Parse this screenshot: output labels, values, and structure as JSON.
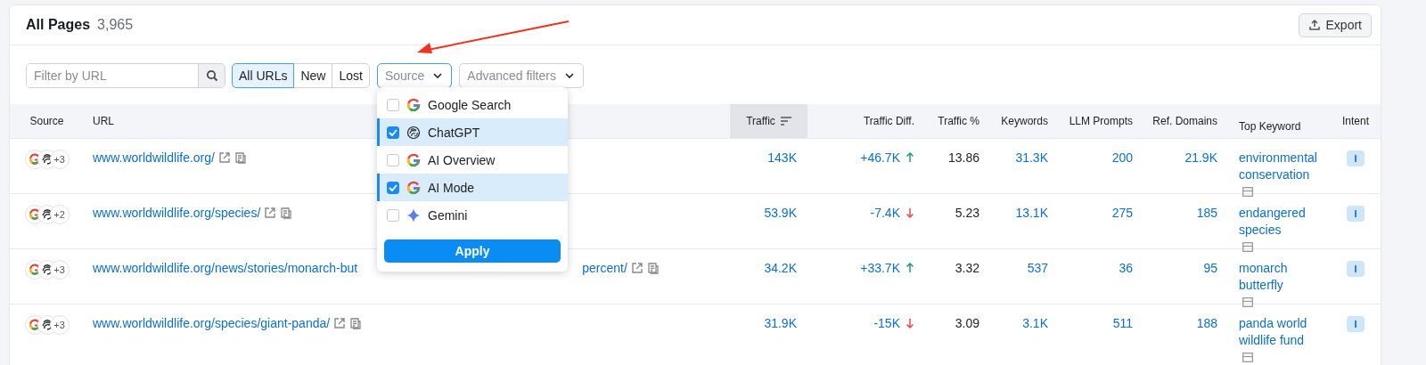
{
  "header": {
    "title": "All Pages",
    "count": "3,965",
    "export_label": "Export"
  },
  "filters": {
    "url_placeholder": "Filter by URL",
    "segments": [
      {
        "label": "All URLs",
        "selected": true
      },
      {
        "label": "New",
        "selected": false
      },
      {
        "label": "Lost",
        "selected": false
      }
    ],
    "source_label": "Source",
    "advanced_label": "Advanced filters"
  },
  "source_menu": {
    "items": [
      {
        "label": "Google Search",
        "kind": "google",
        "checked": false
      },
      {
        "label": "ChatGPT",
        "kind": "chatgpt",
        "checked": true
      },
      {
        "label": "AI Overview",
        "kind": "google",
        "checked": false
      },
      {
        "label": "AI Mode",
        "kind": "google",
        "checked": true
      },
      {
        "label": "Gemini",
        "kind": "gemini",
        "checked": false
      }
    ],
    "apply_label": "Apply"
  },
  "table": {
    "columns": [
      {
        "label": "Source",
        "sorted": false
      },
      {
        "label": "URL",
        "sorted": false
      },
      {
        "label": "Traffic",
        "sorted": true
      },
      {
        "label": "Traffic Diff.",
        "sorted": false
      },
      {
        "label": "Traffic %",
        "sorted": false
      },
      {
        "label": "Keywords",
        "sorted": false
      },
      {
        "label": "LLM Prompts",
        "sorted": false
      },
      {
        "label": "Ref. Domains",
        "sorted": false
      },
      {
        "label": "Top Keyword",
        "sorted": false
      },
      {
        "label": "Intent",
        "sorted": false
      }
    ],
    "rows": [
      {
        "more_sources": "+3",
        "url_parts": [
          "www.worldwildlife.org/"
        ],
        "traffic": "143K",
        "diff": "+46.7K",
        "rising": true,
        "traffic_pct": "13.86",
        "keywords": "31.3K",
        "llm_prompts": "200",
        "ref_domains": "21.9K",
        "top_keyword": "environmental conservation",
        "intent": "I"
      },
      {
        "more_sources": "+2",
        "url_parts": [
          "www.worldwildlife.org/species/"
        ],
        "traffic": "53.9K",
        "diff": "-7.4K",
        "rising": false,
        "traffic_pct": "5.23",
        "keywords": "13.1K",
        "llm_prompts": "275",
        "ref_domains": "185",
        "top_keyword": "endangered species",
        "intent": "I"
      },
      {
        "more_sources": "+3",
        "url_parts": [
          "www.worldwildlife.org/news/stories/monarch-but",
          "percent/"
        ],
        "traffic": "34.2K",
        "diff": "+33.7K",
        "rising": true,
        "traffic_pct": "3.32",
        "keywords": "537",
        "llm_prompts": "36",
        "ref_domains": "95",
        "top_keyword": "monarch butterfly",
        "intent": "I"
      },
      {
        "more_sources": "+3",
        "url_parts": [
          "www.worldwildlife.org/species/giant-panda/"
        ],
        "traffic": "31.9K",
        "diff": "-15K",
        "rising": false,
        "traffic_pct": "3.09",
        "keywords": "3.1K",
        "llm_prompts": "511",
        "ref_domains": "188",
        "top_keyword": "panda world wildlife fund",
        "intent": "I"
      }
    ]
  }
}
